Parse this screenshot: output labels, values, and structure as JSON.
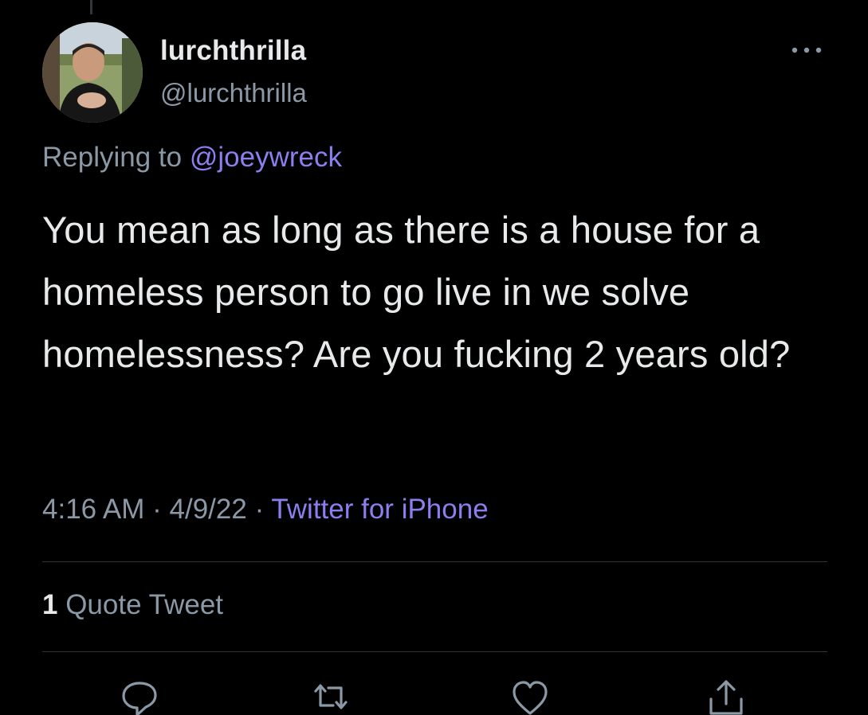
{
  "author": {
    "display_name": "lurchthrilla",
    "handle": "@lurchthrilla",
    "avatar_icon": "profile-photo"
  },
  "reply": {
    "prefix": "Replying to",
    "mention": "@joeywreck"
  },
  "tweet": {
    "text": "You mean as long as there is a house for a homeless person to go live in we solve homelessness? Are you fucking 2 years old?"
  },
  "meta": {
    "time": "4:16 AM",
    "sep1": " · ",
    "date": "4/9/22",
    "sep2": " · ",
    "source": "Twitter for iPhone"
  },
  "engagement": {
    "quote_count": "1",
    "quote_label": "Quote Tweet"
  },
  "actions": [
    {
      "icon": "reply-icon"
    },
    {
      "icon": "retweet-icon"
    },
    {
      "icon": "like-icon"
    },
    {
      "icon": "share-icon"
    }
  ],
  "colors": {
    "background": "#000000",
    "text": "#e7e9ea",
    "secondary_text": "#8b98a5",
    "accent": "#8b7ff0",
    "divider": "#2f3336"
  }
}
